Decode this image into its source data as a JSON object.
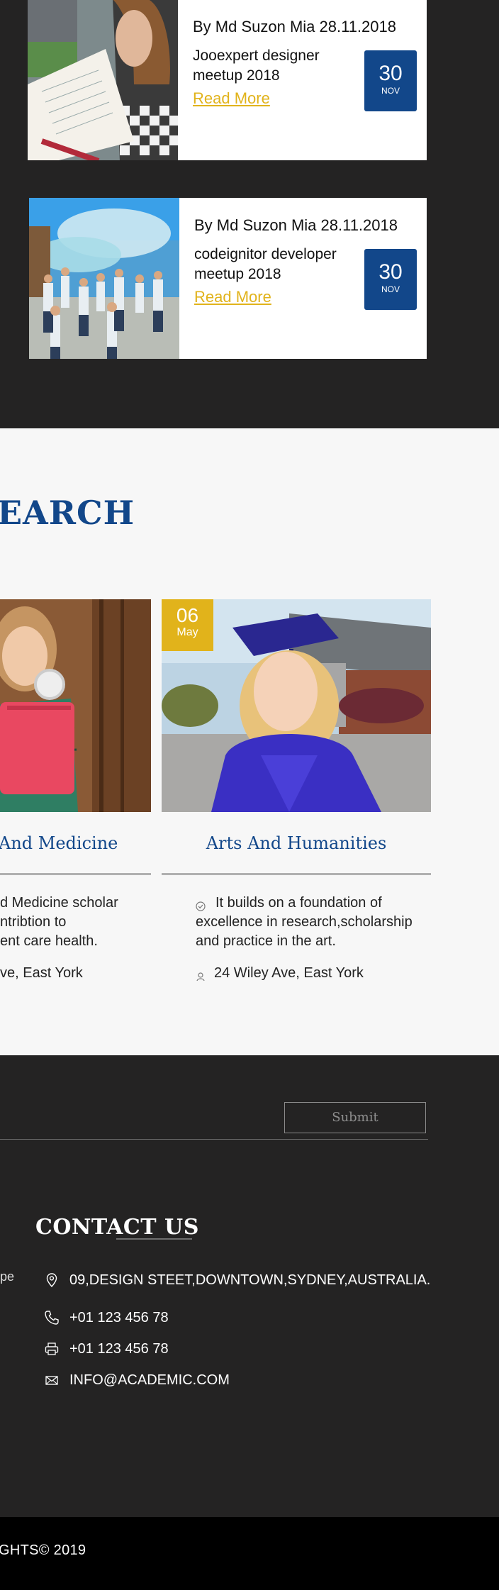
{
  "events": [
    {
      "meta": "By Md Suzon Mia 28.11.2018",
      "title": "Jooexpert designer meetup 2018",
      "link": "Read More",
      "day": "30",
      "month": "NOV"
    },
    {
      "meta": "By Md Suzon Mia 28.11.2018",
      "title": "codeignitor developer meetup 2018",
      "link": "Read More",
      "day": "30",
      "month": "NOV"
    }
  ],
  "research": {
    "title_fragment": "EARCH",
    "courses": [
      {
        "title": "And Medicine",
        "desc": "d Medicine scholar ntribtion to ent care health.",
        "desc_lines": [
          "d Medicine scholar",
          "ntribtion to",
          "ent care health."
        ],
        "location": "ve, East York"
      },
      {
        "date_day": "06",
        "date_month": "May",
        "title": "Arts And Humanities",
        "desc": "It builds on a foundation of excellence in research,scholarship and practice in the art.",
        "location": "24 Wiley Ave, East York"
      }
    ]
  },
  "footer": {
    "submit_label": "Submit",
    "contact_title": "CONTACT US",
    "side_fragment": "pe",
    "contacts": [
      {
        "icon": "map-pin-icon",
        "text": "09,DESIGN STEET,DOWNTOWN,SYDNEY,AUSTRALIA."
      },
      {
        "icon": "phone-icon",
        "text": "+01 123 456 78"
      },
      {
        "icon": "printer-icon",
        "text": "+01 123 456 78"
      },
      {
        "icon": "envelope-icon",
        "text": "INFO@ACADEMIC.COM"
      }
    ],
    "copyright": "GHTS© 2019"
  },
  "colors": {
    "primary": "#12478a",
    "accent": "#e1b31b",
    "dark": "#242323",
    "light": "#f7f7f7"
  }
}
